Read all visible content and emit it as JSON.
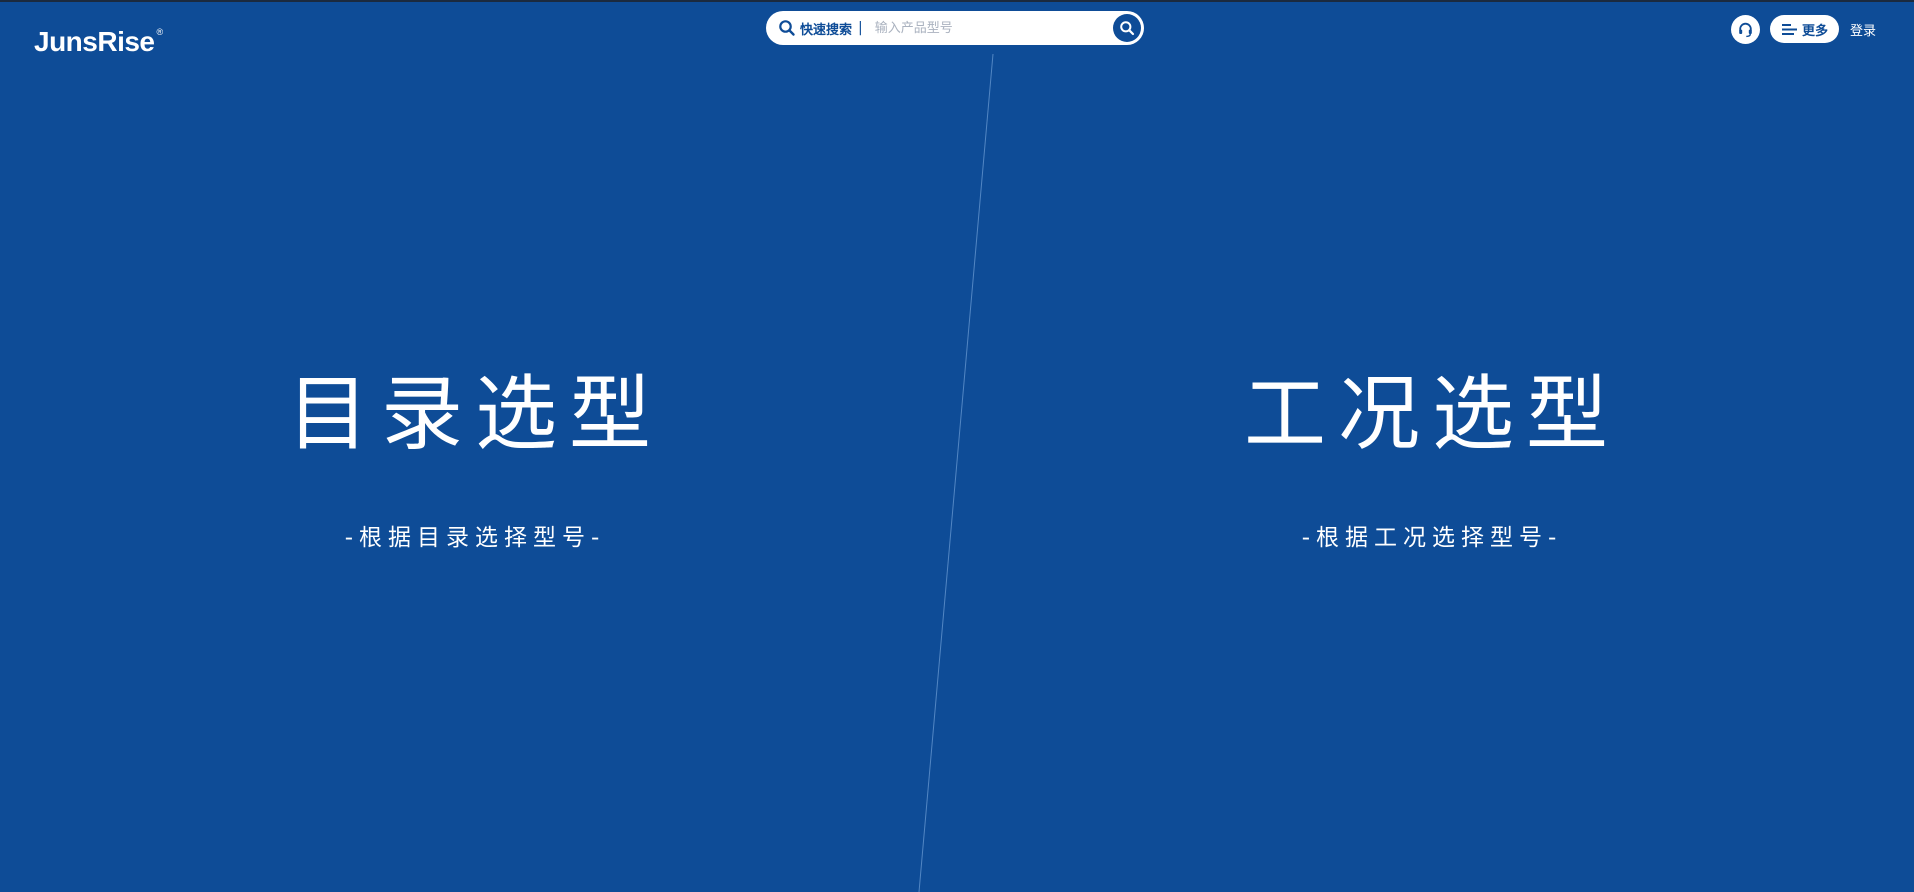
{
  "header": {
    "logo_text": "JunsRise",
    "logo_mark": "®",
    "search": {
      "label": "快速搜索",
      "separator": "|",
      "placeholder": "输入产品型号",
      "value": "",
      "leading_icon": "search-icon",
      "submit_icon": "search-icon"
    },
    "support_icon": "headset-icon",
    "more_icon": "menu-lines-icon",
    "more_label": "更多",
    "login_label": "登录"
  },
  "panels": [
    {
      "title": "目录选型",
      "subtitle": "-根据目录选择型号-"
    },
    {
      "title": "工况选型",
      "subtitle": "-根据工况选择型号-"
    }
  ],
  "colors": {
    "background": "#0e4c97",
    "text": "#ffffff",
    "accent": "#0e4c97",
    "divider": "#6f9fd6"
  }
}
